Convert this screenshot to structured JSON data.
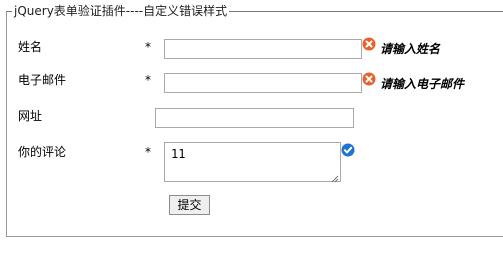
{
  "form": {
    "legend": "jQuery表单验证插件----自定义错误样式",
    "required_mark": "*",
    "fields": {
      "name": {
        "label": "姓名",
        "value": "",
        "error": "请输入姓名",
        "status": "error"
      },
      "email": {
        "label": "电子邮件",
        "value": "",
        "error": "请输入电子邮件",
        "status": "error"
      },
      "website": {
        "label": "网址",
        "value": ""
      },
      "comment": {
        "label": "你的评论",
        "value": "11",
        "status": "valid"
      }
    },
    "submit_label": "提交"
  },
  "icons": {
    "error": "error-x-icon",
    "valid": "checkmark-icon"
  },
  "colors": {
    "error_icon": "#e8602c",
    "valid_icon": "#1f73d1"
  }
}
